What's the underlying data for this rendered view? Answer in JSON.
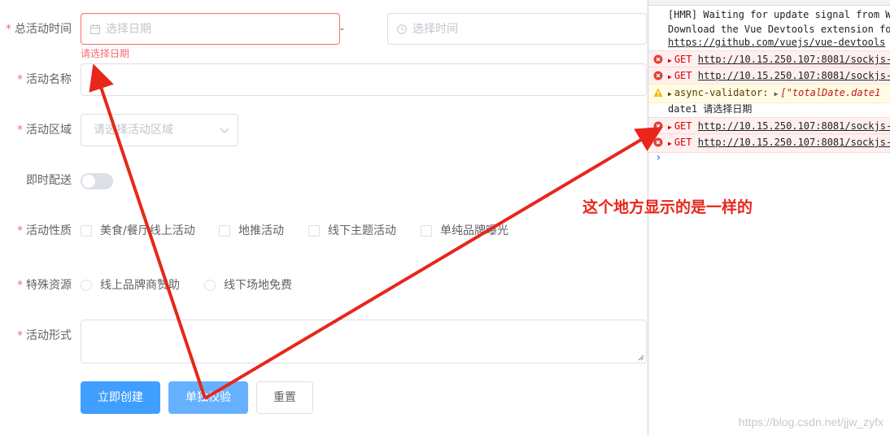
{
  "form": {
    "total_time": {
      "label": "总活动时间",
      "date_placeholder": "选择日期",
      "separator": "-",
      "time_placeholder": "选择时间",
      "error": "请选择日期"
    },
    "name": {
      "label": "活动名称",
      "value": ""
    },
    "region": {
      "label": "活动区域",
      "placeholder": "请选择活动区域"
    },
    "delivery": {
      "label": "即时配送",
      "on": false
    },
    "nature": {
      "label": "活动性质",
      "options": [
        "美食/餐厅线上活动",
        "地推活动",
        "线下主题活动",
        "单纯品牌曝光"
      ]
    },
    "resource": {
      "label": "特殊资源",
      "options": [
        "线上品牌商赞助",
        "线下场地免费"
      ]
    },
    "form_type": {
      "label": "活动形式",
      "value": ""
    },
    "buttons": {
      "create": "立即创建",
      "validate": "单独校验",
      "reset": "重置"
    }
  },
  "console": {
    "rows": [
      {
        "level": "log",
        "text": "[HMR] Waiting for update signal from W"
      },
      {
        "level": "log",
        "text": "Download the Vue Devtools extension fo",
        "link": "https://github.com/vuejs/vue-devtools"
      },
      {
        "level": "error",
        "method": "GET",
        "link": "http://10.15.250.107:8081/sockjs-"
      },
      {
        "level": "error",
        "method": "GET",
        "link": "http://10.15.250.107:8081/sockjs-"
      },
      {
        "level": "warn",
        "text": "async-validator: ",
        "value": "[\"totalDate.date1"
      },
      {
        "level": "log",
        "text": "date1 请选择日期"
      },
      {
        "level": "error",
        "method": "GET",
        "link": "http://10.15.250.107:8081/sockjs-"
      },
      {
        "level": "error",
        "method": "GET",
        "link": "http://10.15.250.107:8081/sockjs-"
      }
    ],
    "prompt": "›"
  },
  "annotation": "这个地方显示的是一样的",
  "watermark": "https://blog.csdn.net/jjw_zyfx",
  "colors": {
    "primary": "#409eff",
    "error": "#f56c6c",
    "annotation": "#e8261c"
  }
}
